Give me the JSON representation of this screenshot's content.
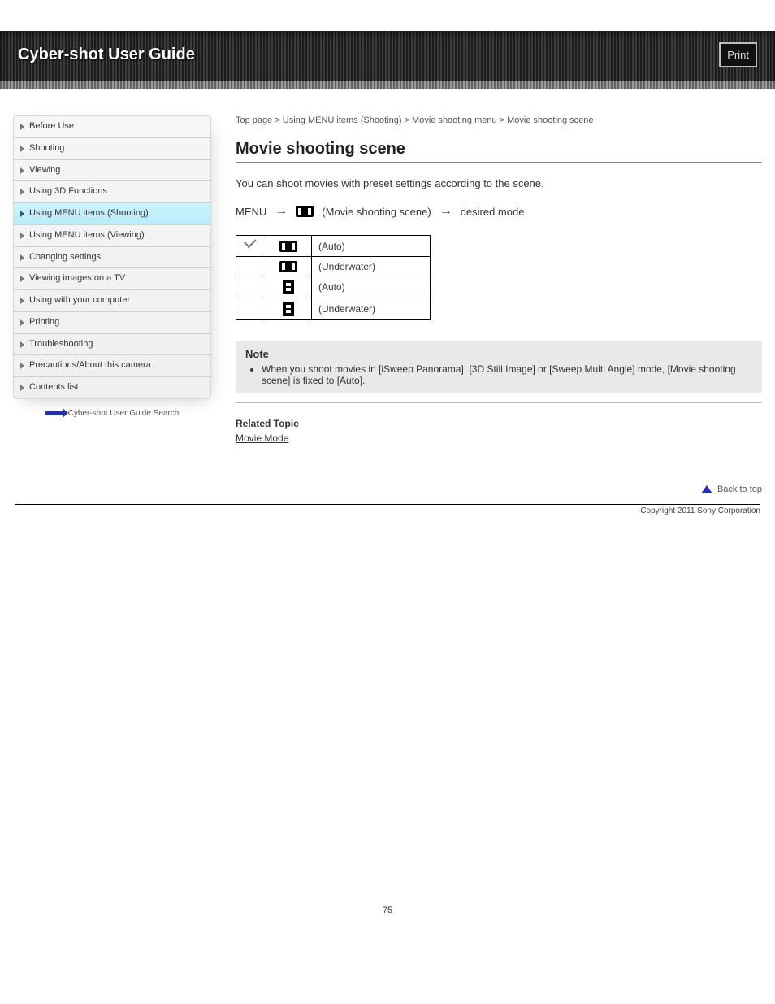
{
  "header": {
    "title": "Cyber-shot User Guide",
    "print_button": "Print"
  },
  "sidebar": {
    "items": [
      {
        "label": "Before Use",
        "active": false
      },
      {
        "label": "Shooting",
        "active": false
      },
      {
        "label": "Viewing",
        "active": false
      },
      {
        "label": "Using 3D Functions",
        "active": false
      },
      {
        "label": "Using MENU items (Shooting)",
        "active": true
      },
      {
        "label": "Using MENU items (Viewing)",
        "active": false
      },
      {
        "label": "Changing settings",
        "active": false
      },
      {
        "label": "Viewing images on a TV",
        "active": false
      },
      {
        "label": "Using with your computer",
        "active": false
      },
      {
        "label": "Printing",
        "active": false
      },
      {
        "label": "Troubleshooting",
        "active": false
      },
      {
        "label": "Precautions/About this camera",
        "active": false
      },
      {
        "label": "Contents list",
        "active": false
      }
    ],
    "search_link": "Cyber-shot User Guide Search"
  },
  "content": {
    "breadcrumb": "Top page > Using MENU items (Shooting) > Movie shooting menu > Movie shooting scene",
    "page_title": "Movie shooting scene",
    "description": "You can shoot movies with preset settings according to the scene.",
    "menu_path": {
      "step1": "MENU",
      "step2_label": "(Movie shooting scene)",
      "step3": "desired mode"
    },
    "options": [
      {
        "icon": "film",
        "label_a": "",
        "label_b": "(Auto)",
        "checked": true
      },
      {
        "icon": "film",
        "label_a": "",
        "label_b": "(Underwater)",
        "checked": false
      },
      {
        "icon": "reel",
        "label_a": "",
        "label_b": "(Auto)",
        "checked": false
      },
      {
        "icon": "reel",
        "label_a": "",
        "label_b": "(Underwater)",
        "checked": false
      }
    ],
    "note": {
      "title": "Note",
      "items": [
        "When you shoot movies in [iSweep Panorama], [3D Still Image] or [Sweep Multi Angle] mode, [Movie shooting scene] is fixed to [Auto]."
      ]
    },
    "related_title": "Related Topic",
    "related_link": "Movie Mode",
    "back_to_top": "Back to top"
  },
  "footer": {
    "copyright": "Copyright 2011 Sony Corporation",
    "page_number": "75"
  }
}
